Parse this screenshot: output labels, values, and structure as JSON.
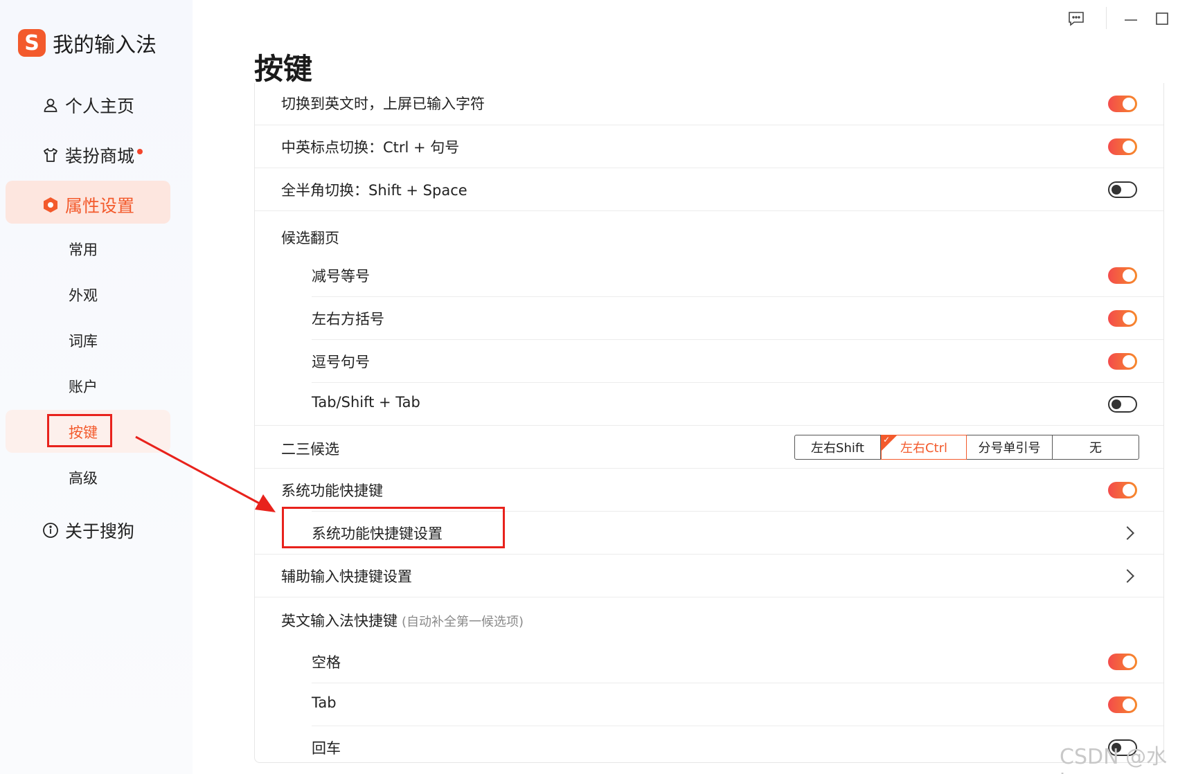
{
  "app": {
    "name": "我的输入法",
    "logo_letter": "S"
  },
  "sidebar": {
    "items": [
      {
        "label": "个人主页",
        "icon": "person-icon"
      },
      {
        "label": "装扮商城",
        "icon": "tshirt-icon",
        "badge_dot": true
      },
      {
        "label": "属性设置",
        "icon": "hexagon-settings-icon",
        "active": true
      },
      {
        "label": "关于搜狗",
        "icon": "info-icon"
      }
    ],
    "sub_items": [
      {
        "label": "常用"
      },
      {
        "label": "外观"
      },
      {
        "label": "词库"
      },
      {
        "label": "账户"
      },
      {
        "label": "按键",
        "active": true
      },
      {
        "label": "高级"
      }
    ]
  },
  "titlebar": {
    "icons": [
      "feedback-icon",
      "minimize-icon",
      "maximize-icon"
    ]
  },
  "page": {
    "title": "按键"
  },
  "settings": {
    "rows": [
      {
        "label": "切换到英文时，上屏已输入字符",
        "control": "toggle",
        "on": true
      },
      {
        "label": "中英标点切换：Ctrl + 句号",
        "control": "toggle",
        "on": true
      },
      {
        "label": "全半角切换：Shift + Space",
        "control": "toggle",
        "on": false
      },
      {
        "label": "候选翻页",
        "control": "none"
      },
      {
        "label": "减号等号",
        "control": "toggle",
        "on": true,
        "indent": true
      },
      {
        "label": "左右方括号",
        "control": "toggle",
        "on": true,
        "indent": true
      },
      {
        "label": "逗号句号",
        "control": "toggle",
        "on": true,
        "indent": true
      },
      {
        "label": "Tab/Shift + Tab",
        "control": "toggle",
        "on": false,
        "indent": true
      },
      {
        "label": "二三候选",
        "control": "segmented"
      },
      {
        "label": "系统功能快捷键",
        "control": "toggle",
        "on": true
      },
      {
        "label": "系统功能快捷键设置",
        "control": "chevron",
        "indent": true
      },
      {
        "label": "辅助输入快捷键设置",
        "control": "chevron"
      },
      {
        "label": "英文输入法快捷键",
        "hint": "(自动补全第一候选项)",
        "control": "none"
      },
      {
        "label": "空格",
        "control": "toggle",
        "on": true,
        "indent": true
      },
      {
        "label": "Tab",
        "control": "toggle",
        "on": true,
        "indent": true
      },
      {
        "label": "回车",
        "control": "toggle",
        "on": false,
        "indent": true
      }
    ],
    "segmented_options": [
      "左右Shift",
      "左右Ctrl",
      "分号单引号",
      "无"
    ],
    "segmented_selected": "左右Ctrl"
  },
  "colors": {
    "accent": "#f35a2c",
    "annotation_red": "#e8221c"
  },
  "watermark": "CSDN @水kw"
}
